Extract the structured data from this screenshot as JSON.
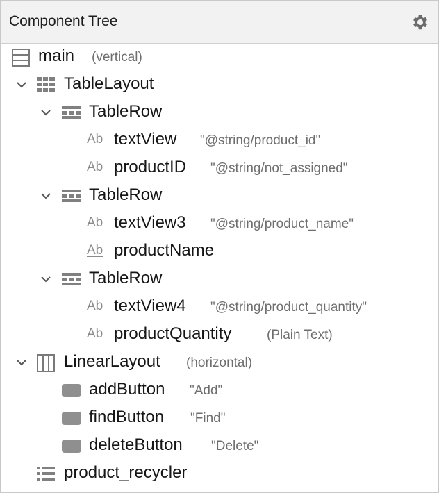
{
  "panel": {
    "title": "Component Tree",
    "settings_icon": "gear-icon"
  },
  "tree": {
    "main": {
      "name": "main",
      "attr": "(vertical)",
      "icon": "vertical-layout-icon"
    },
    "table_layout": {
      "name": "TableLayout",
      "icon": "table-layout-icon",
      "expanded": true
    },
    "row1": {
      "name": "TableRow",
      "icon": "table-row-icon",
      "expanded": true
    },
    "row1_text": {
      "name": "textView",
      "attr": "\"@string/product_id\"",
      "icon": "textview-icon",
      "icon_text": "Ab"
    },
    "row1_value": {
      "name": "productID",
      "attr": "\"@string/not_assigned\"",
      "icon": "textview-icon",
      "icon_text": "Ab"
    },
    "row2": {
      "name": "TableRow",
      "icon": "table-row-icon",
      "expanded": true
    },
    "row2_text": {
      "name": "textView3",
      "attr": "\"@string/product_name\"",
      "icon": "textview-icon",
      "icon_text": "Ab"
    },
    "row2_value": {
      "name": "productName",
      "icon": "edittext-icon",
      "icon_text": "Ab"
    },
    "row3": {
      "name": "TableRow",
      "icon": "table-row-icon",
      "expanded": true
    },
    "row3_text": {
      "name": "textView4",
      "attr": "\"@string/product_quantity\"",
      "icon": "textview-icon",
      "icon_text": "Ab"
    },
    "row3_value": {
      "name": "productQuantity",
      "attr": "(Plain Text)",
      "icon": "edittext-icon",
      "icon_text": "Ab"
    },
    "linear_layout": {
      "name": "LinearLayout",
      "attr": "(horizontal)",
      "icon": "horizontal-layout-icon",
      "expanded": true
    },
    "add_button": {
      "name": "addButton",
      "attr": "\"Add\"",
      "icon": "button-icon"
    },
    "find_button": {
      "name": "findButton",
      "attr": "\"Find\"",
      "icon": "button-icon"
    },
    "delete_button": {
      "name": "deleteButton",
      "attr": "\"Delete\"",
      "icon": "button-icon"
    },
    "recycler": {
      "name": "product_recycler",
      "icon": "recyclerview-icon"
    }
  }
}
